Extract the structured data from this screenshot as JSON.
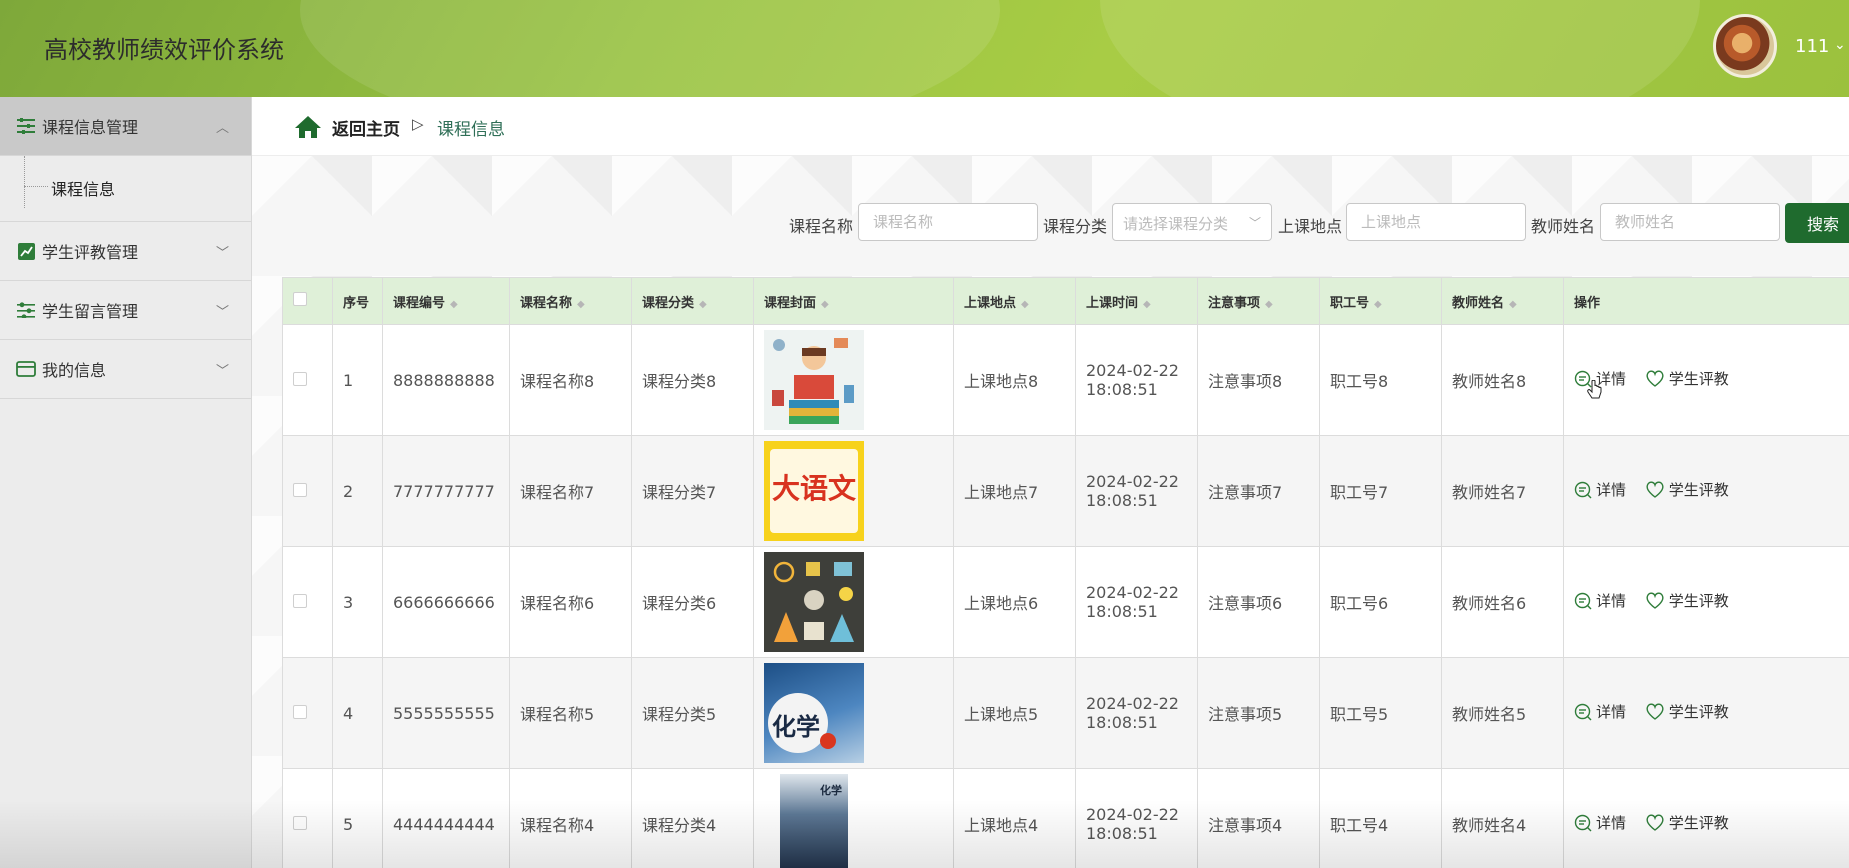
{
  "app": {
    "title": "高校教师绩效评价系统",
    "user": "111"
  },
  "sidebar": {
    "menus": [
      {
        "label": "课程信息管理",
        "icon": "list-icon",
        "expanded": true,
        "children": [
          "课程信息"
        ]
      },
      {
        "label": "学生评教管理",
        "icon": "chart-icon",
        "expanded": false
      },
      {
        "label": "学生留言管理",
        "icon": "sliders-icon",
        "expanded": false
      },
      {
        "label": "我的信息",
        "icon": "card-icon",
        "expanded": false
      }
    ]
  },
  "breadcrumb": {
    "home": "返回主页",
    "separator": "▷",
    "current": "课程信息"
  },
  "search": {
    "name_label": "课程名称",
    "name_placeholder": "课程名称",
    "category_label": "课程分类",
    "category_placeholder": "请选择课程分类",
    "location_label": "上课地点",
    "location_placeholder": "上课地点",
    "teacher_label": "教师姓名",
    "teacher_placeholder": "教师姓名",
    "button": "搜索"
  },
  "table": {
    "headers": [
      "序号",
      "课程编号",
      "课程名称",
      "课程分类",
      "课程封面",
      "上课地点",
      "上课时间",
      "注意事项",
      "职工号",
      "教师姓名",
      "操作"
    ],
    "rows": [
      {
        "index": "1",
        "code": "8888888888",
        "name": "课程名称8",
        "category": "课程分类8",
        "cover": "teacher-books-cover",
        "location": "上课地点8",
        "date": "2024-02-22",
        "time": "18:08:51",
        "notes": "注意事项8",
        "staff_no": "职工号8",
        "teacher": "教师姓名8"
      },
      {
        "index": "2",
        "code": "7777777777",
        "name": "课程名称7",
        "category": "课程分类7",
        "cover": "chinese-book-cover",
        "cover_text": "大语文",
        "location": "上课地点7",
        "date": "2024-02-22",
        "time": "18:08:51",
        "notes": "注意事项7",
        "staff_no": "职工号7",
        "teacher": "教师姓名7"
      },
      {
        "index": "3",
        "code": "6666666666",
        "name": "课程名称6",
        "category": "课程分类6",
        "cover": "science-cover",
        "location": "上课地点6",
        "date": "2024-02-22",
        "time": "18:08:51",
        "notes": "注意事项6",
        "staff_no": "职工号6",
        "teacher": "教师姓名6"
      },
      {
        "index": "4",
        "code": "5555555555",
        "name": "课程名称5",
        "category": "课程分类5",
        "cover": "chemistry-cover",
        "cover_text": "化学",
        "location": "上课地点5",
        "date": "2024-02-22",
        "time": "18:08:51",
        "notes": "注意事项5",
        "staff_no": "职工号5",
        "teacher": "教师姓名5"
      },
      {
        "index": "5",
        "code": "4444444444",
        "name": "课程名称4",
        "category": "课程分类4",
        "cover": "chemistry-book-cover",
        "cover_text": "化学",
        "location": "上课地点4",
        "date": "2024-02-22",
        "time": "18:08:51",
        "notes": "注意事项4",
        "staff_no": "职工号4",
        "teacher": "教师姓名4"
      }
    ],
    "actions": {
      "detail": "详情",
      "evaluate": "学生评教"
    }
  },
  "colors": {
    "header_green": "#9bc13e",
    "table_header": "#dff0d8",
    "button_green": "#1f6b2e",
    "accent": "#2f6f57"
  }
}
